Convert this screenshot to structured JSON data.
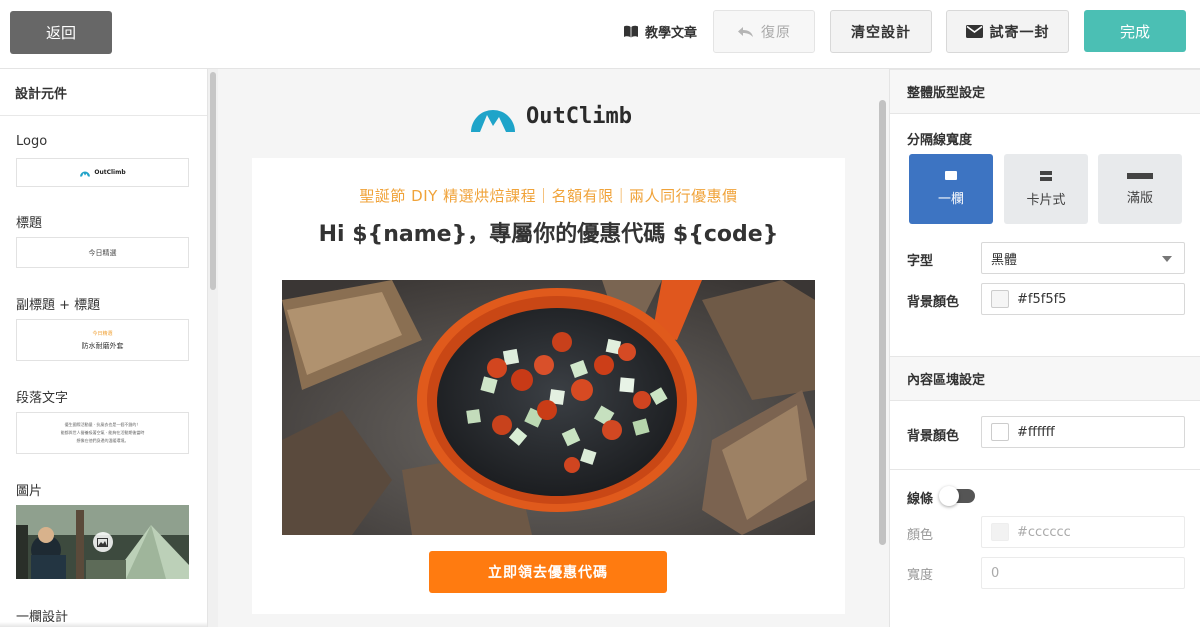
{
  "topbar": {
    "back_label": "返回",
    "tutorial_label": "教學文章",
    "undo_label": "復原",
    "clear_label": "清空設計",
    "test_send_label": "試寄一封",
    "done_label": "完成"
  },
  "left_panel": {
    "title": "設計元件",
    "components": [
      {
        "label": "Logo",
        "preview": "OutClimb"
      },
      {
        "label": "標題",
        "preview": "今日精選"
      },
      {
        "label": "副標題 + 標題",
        "preview_sub": "今日精選",
        "preview_title": "防水耐磨外套"
      },
      {
        "label": "段落文字",
        "preview_lines": [
          "優生國際活動量 · 抗風衣也是一個不錯的！",
          "能都與世人營養吸著空氣 · 能夠在活動期後當時",
          "想像在他們身邊的溫暖環境。"
        ]
      },
      {
        "label": "圖片"
      },
      {
        "label": "一欄設計"
      }
    ]
  },
  "canvas": {
    "logo_text": "OutClimb",
    "subtitle": "聖誕節 DIY 精選烘焙課程｜名額有限｜兩人同行優惠價",
    "headline": "Hi ${name}，專屬你的優惠代碼 ${code}",
    "cta_label": "立即領去優惠代碼",
    "background_color": "#f5f5f5",
    "content_background": "#ffffff",
    "cta_color": "#ff7b10",
    "subtitle_color": "#f0a33a"
  },
  "right_panel": {
    "section_layout": "整體版型設定",
    "divider_width_label": "分隔線寬度",
    "layout_options": [
      {
        "label": "一欄",
        "active": true
      },
      {
        "label": "卡片式",
        "active": false
      },
      {
        "label": "滿版",
        "active": false
      }
    ],
    "font_label": "字型",
    "font_value": "黑體",
    "bg_color_label": "背景顏色",
    "bg_color_value": "#f5f5f5",
    "section_content": "內容區塊設定",
    "content_bg_label": "背景顏色",
    "content_bg_value": "#ffffff",
    "line_label": "線條",
    "line_enabled": false,
    "line_color_label": "顏色",
    "line_color_value": "#cccccc",
    "line_width_label": "寬度",
    "line_width_value": "0"
  }
}
